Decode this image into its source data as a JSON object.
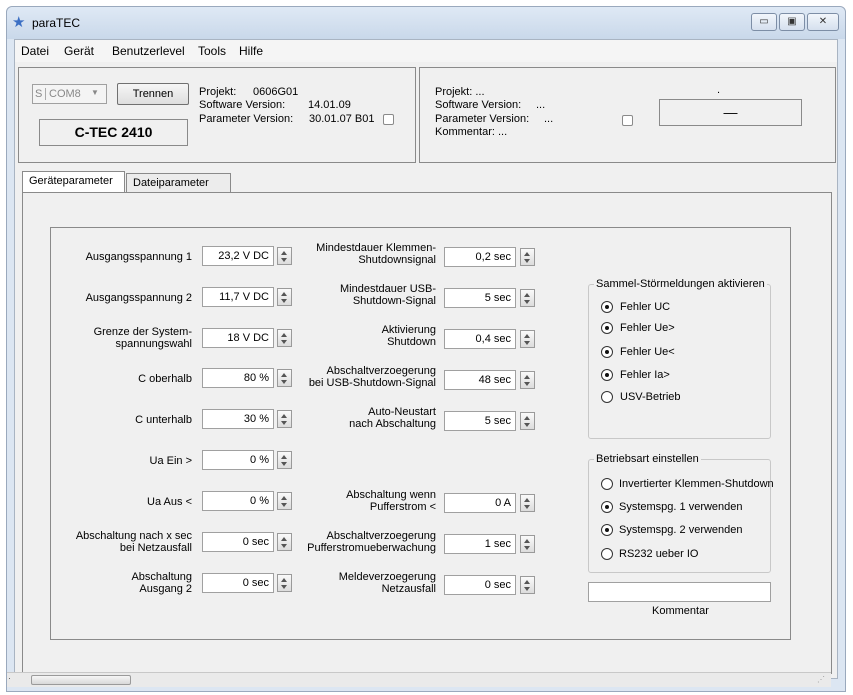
{
  "window": {
    "title": "paraTEC",
    "minimize": "▭",
    "maximize": "▣",
    "close": "✕"
  },
  "menu": [
    "Datei",
    "Gerät",
    "Benutzerlevel",
    "Tools",
    "Hilfe"
  ],
  "connection": {
    "s_label": "S",
    "port": "COM8",
    "disconnect_button": "Trennen",
    "device_name": "C-TEC 2410",
    "project_label": "Projekt:",
    "project_value": "0606G01",
    "sw_label": "Software Version:",
    "sw_value": "14.01.09",
    "param_label": "Parameter Version:",
    "param_value": "30.01.07 B01"
  },
  "file_info": {
    "project": "Projekt:     ...",
    "sw": "Software Version:",
    "sw_value": "...",
    "param": "Parameter Version:",
    "param_value": "...",
    "comment": "Kommentar: ...",
    "dot": ".",
    "display_value": "—"
  },
  "tabs": [
    "Geräteparameter",
    "Dateiparameter"
  ],
  "params_left": [
    {
      "label": "Ausgangsspannung 1",
      "value": "23,2 V DC"
    },
    {
      "label": "Ausgangsspannung 2",
      "value": "11,7 V DC"
    },
    {
      "label": "Grenze der System-\nspannungswahl",
      "value": "18 V DC"
    },
    {
      "label": "C oberhalb",
      "value": "80 %"
    },
    {
      "label": "C unterhalb",
      "value": "30 %"
    },
    {
      "label": "Ua Ein  >",
      "value": "0 %"
    },
    {
      "label": "Ua Aus  <",
      "value": "0 %"
    },
    {
      "label": "Abschaltung nach x sec\nbei Netzausfall",
      "value": "0 sec"
    },
    {
      "label": "Abschaltung\nAusgang 2",
      "value": "0 sec"
    }
  ],
  "params_mid": [
    {
      "label": "Mindestdauer Klemmen-\nShutdownsignal",
      "value": "0,2 sec"
    },
    {
      "label": "Mindestdauer USB-\nShutdown-Signal",
      "value": "5 sec"
    },
    {
      "label": "Aktivierung\nShutdown",
      "value": "0,4 sec"
    },
    {
      "label": "Abschaltverzoegerung\nbei USB-Shutdown-Signal",
      "value": "48 sec"
    },
    {
      "label": "Auto-Neustart\nnach Abschaltung",
      "value": "5 sec"
    },
    {
      "label": "Abschaltung wenn\nPufferstrom <",
      "value": "0 A"
    },
    {
      "label": "Abschaltverzoegerung\nPufferstromueberwachung",
      "value": "1 sec"
    },
    {
      "label": "Meldeverzoegerung\nNetzausfall",
      "value": "0 sec"
    }
  ],
  "alarms": {
    "title": "Sammel-Störmeldungen aktivieren",
    "options": [
      {
        "label": "Fehler UC",
        "on": true
      },
      {
        "label": "Fehler Ue>",
        "on": true
      },
      {
        "label": "Fehler Ue<",
        "on": true
      },
      {
        "label": "Fehler Ia>",
        "on": true
      },
      {
        "label": "USV-Betrieb",
        "on": false
      }
    ]
  },
  "mode": {
    "title": "Betriebsart einstellen",
    "options": [
      {
        "label": "Invertierter Klemmen-Shutdown",
        "on": false
      },
      {
        "label": "Systemspg. 1 verwenden",
        "on": true
      },
      {
        "label": "Systemspg. 2 verwenden",
        "on": true
      },
      {
        "label": "RS232 ueber IO",
        "on": false
      }
    ]
  },
  "comment": {
    "value": "",
    "label": "Kommentar"
  }
}
